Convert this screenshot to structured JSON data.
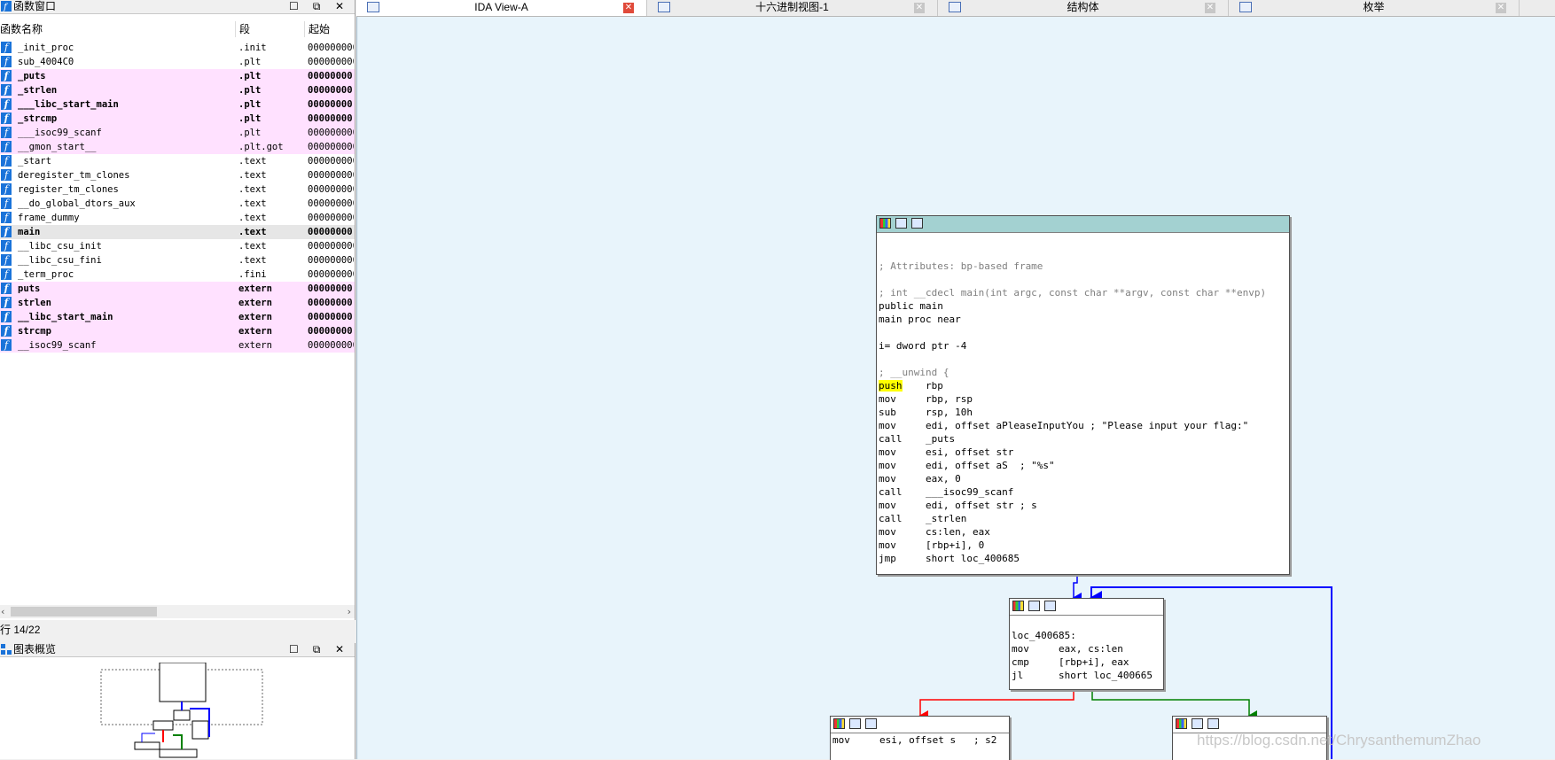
{
  "function_window": {
    "title": "函数窗口",
    "window_buttons": [
      "☐",
      "⧉",
      "✕"
    ],
    "columns": {
      "name": "函数名称",
      "segment": "段",
      "start": "起始"
    },
    "rows": [
      {
        "name": "_init_proc",
        "segment": ".init",
        "start": "000000000",
        "style": "normal"
      },
      {
        "name": "sub_4004C0",
        "segment": ".plt",
        "start": "000000000",
        "style": "normal"
      },
      {
        "name": "_puts",
        "segment": ".plt",
        "start": "00000000",
        "style": "pink-bold"
      },
      {
        "name": "_strlen",
        "segment": ".plt",
        "start": "00000000",
        "style": "pink-bold"
      },
      {
        "name": "___libc_start_main",
        "segment": ".plt",
        "start": "00000000",
        "style": "pink-bold"
      },
      {
        "name": "_strcmp",
        "segment": ".plt",
        "start": "00000000",
        "style": "pink-bold"
      },
      {
        "name": "___isoc99_scanf",
        "segment": ".plt",
        "start": "000000000",
        "style": "pink"
      },
      {
        "name": "__gmon_start__",
        "segment": ".plt.got",
        "start": "000000000",
        "style": "pink"
      },
      {
        "name": "_start",
        "segment": ".text",
        "start": "000000000",
        "style": "normal"
      },
      {
        "name": "deregister_tm_clones",
        "segment": ".text",
        "start": "000000000",
        "style": "normal"
      },
      {
        "name": "register_tm_clones",
        "segment": ".text",
        "start": "000000000",
        "style": "normal"
      },
      {
        "name": "__do_global_dtors_aux",
        "segment": ".text",
        "start": "000000000",
        "style": "normal"
      },
      {
        "name": "frame_dummy",
        "segment": ".text",
        "start": "000000000",
        "style": "normal"
      },
      {
        "name": "main",
        "segment": ".text",
        "start": "00000000",
        "style": "selected-bold"
      },
      {
        "name": "__libc_csu_init",
        "segment": ".text",
        "start": "000000000",
        "style": "normal"
      },
      {
        "name": "__libc_csu_fini",
        "segment": ".text",
        "start": "000000000",
        "style": "normal"
      },
      {
        "name": "_term_proc",
        "segment": ".fini",
        "start": "000000000",
        "style": "normal"
      },
      {
        "name": "puts",
        "segment": "extern",
        "start": "00000000",
        "style": "pink-bold"
      },
      {
        "name": "strlen",
        "segment": "extern",
        "start": "00000000",
        "style": "pink-bold"
      },
      {
        "name": "__libc_start_main",
        "segment": "extern",
        "start": "00000000",
        "style": "pink-bold"
      },
      {
        "name": "strcmp",
        "segment": "extern",
        "start": "00000000",
        "style": "pink-bold"
      },
      {
        "name": "__isoc99_scanf",
        "segment": "extern",
        "start": "000000000",
        "style": "pink"
      }
    ],
    "status": "行 14/22"
  },
  "graph_overview": {
    "title": "图表概览",
    "window_buttons": [
      "☐",
      "⧉",
      "✕"
    ]
  },
  "tabs": [
    {
      "label": "IDA View-A",
      "active": true
    },
    {
      "label": "十六进制视图-1",
      "active": false
    },
    {
      "label": "结构体",
      "active": false
    },
    {
      "label": "枚举",
      "active": false
    }
  ],
  "graph": {
    "main_block": {
      "lines": [
        "",
        "",
        "; Attributes: bp-based frame",
        "",
        "; int __cdecl main(int argc, const char **argv, const char **envp)",
        "public main",
        "main proc near",
        "",
        "i= dword ptr -4",
        "",
        "; __unwind {",
        "push    rbp",
        "mov     rbp, rsp",
        "sub     rsp, 10h",
        "mov     edi, offset aPleaseInputYou ; \"Please input your flag:\"",
        "call    _puts",
        "mov     esi, offset str",
        "mov     edi, offset aS  ; \"%s\"",
        "mov     eax, 0",
        "call    ___isoc99_scanf",
        "mov     edi, offset str ; s",
        "call    _strlen",
        "mov     cs:len, eax",
        "mov     [rbp+i], 0",
        "jmp     short loc_400685"
      ]
    },
    "loop_block": {
      "lines": [
        "",
        "loc_400685:",
        "mov     eax, cs:len",
        "cmp     [rbp+i], eax",
        "jl      short loc_400665"
      ]
    },
    "left_block": {
      "lines": [
        "mov     esi, offset s   ; s2"
      ]
    },
    "right_block": {
      "lines": [
        ""
      ]
    },
    "edge_colors": {
      "unconditional": "#0000ff",
      "false_branch": "#ff0000",
      "true_branch": "#008000"
    }
  },
  "watermark": "https://blog.csdn.net/ChrysanthemumZhao"
}
